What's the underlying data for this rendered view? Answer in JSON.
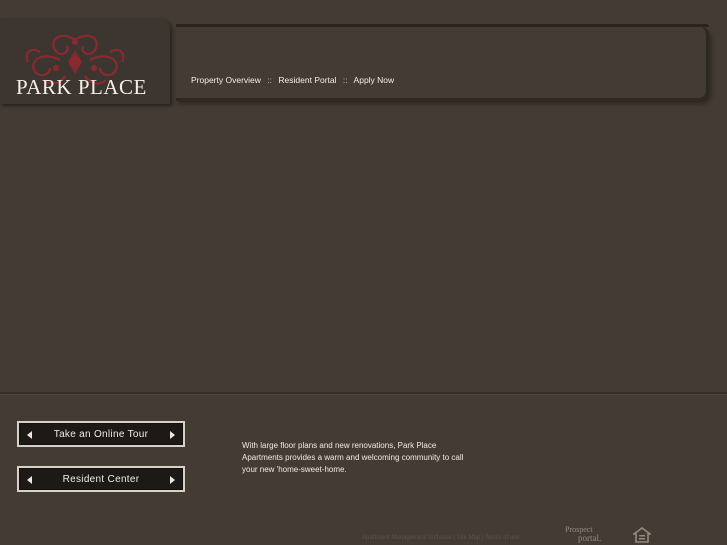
{
  "brand": {
    "name": "PARK PLACE"
  },
  "nav": {
    "items": [
      {
        "label": "Property Overview"
      },
      {
        "label": "Resident Portal"
      },
      {
        "label": "Apply Now"
      }
    ],
    "separator": "::"
  },
  "buttons": {
    "tour": "Take an Online Tour",
    "resident": "Resident Center"
  },
  "description": "With large floor plans and new renovations, Park Place Apartments provides a warm and welcoming community to call your new 'home-sweet-home.",
  "footer": {
    "links": [
      "Apartment Management Software",
      "Site Map",
      "Terms of use"
    ],
    "divider": "|",
    "prospect_line1": "Prospect",
    "prospect_line2": "portal."
  },
  "colors": {
    "background": "#433b34",
    "ornament": "#8a2a30",
    "button_border": "#d8d1c6"
  },
  "icons": [
    "ornament-logo-icon",
    "arrow-left-icon",
    "arrow-right-icon",
    "equal-housing-icon"
  ]
}
